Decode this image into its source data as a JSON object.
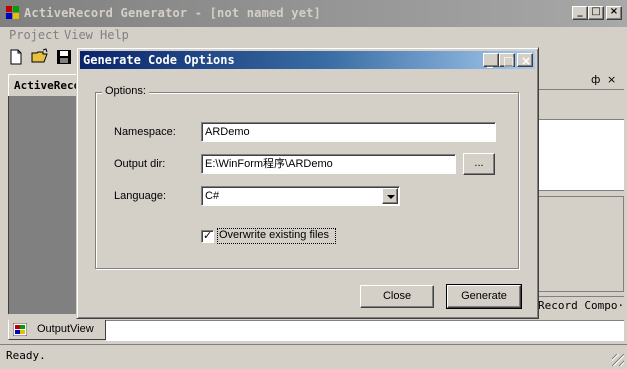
{
  "main_window": {
    "title": "ActiveRecord Generator - [not named yet]",
    "caption_buttons": {
      "minimize": "_",
      "maximize": "□",
      "close": "×"
    }
  },
  "menubar": {
    "items": [
      "Project",
      "View",
      "Help"
    ]
  },
  "toolbar": {
    "icons": [
      "new-file-icon",
      "open-folder-icon",
      "save-disk-icon"
    ]
  },
  "left_panel": {
    "title": "ActiveRecord"
  },
  "right_dock": {
    "pin": "ф",
    "close": "×",
    "tab_label": "Record Compo···"
  },
  "bottom_tabs": {
    "output_view": "OutputView"
  },
  "status_bar": {
    "text": "Ready."
  },
  "dialog": {
    "title": "Generate Code Options",
    "caption_buttons": {
      "minimize": "_",
      "maximize": "□",
      "close": "×"
    },
    "group_label": "Options:",
    "namespace_label": "Namespace:",
    "namespace_value": "ARDemo",
    "output_dir_label": "Output dir:",
    "output_dir_value": "E:\\WinForm程序\\ARDemo",
    "browse_label": "...",
    "language_label": "Language:",
    "language_value": "C#",
    "overwrite_label": "Overwrite existing files",
    "overwrite_checked": "✓",
    "close_label": "Close",
    "generate_label": "Generate"
  },
  "colors": {
    "dialog_title_start": "#0a246a",
    "dialog_title_end": "#a6caf0",
    "inactive_title": "#808080",
    "face": "#d4d0c8"
  }
}
